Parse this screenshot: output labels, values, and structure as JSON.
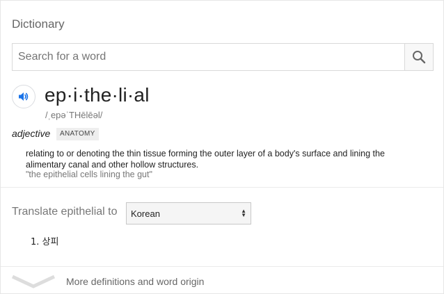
{
  "heading": "Dictionary",
  "search": {
    "placeholder": "Search for a word",
    "value": ""
  },
  "entry": {
    "word": "ep·i·the·li·al",
    "phonetic": "/ˌepəˈTHēlēəl/",
    "part_of_speech": "adjective",
    "label": "ANATOMY",
    "definition": "relating to or denoting the thin tissue forming the outer layer of a body's surface and lining the alimentary canal and other hollow structures.",
    "example": "\"the epithelial cells lining the gut\""
  },
  "translate": {
    "label": "Translate epithelial to",
    "selected_language": "Korean",
    "results": [
      {
        "number": "1.",
        "text": "상피"
      }
    ]
  },
  "footer": {
    "more_label": "More definitions and word origin"
  },
  "colors": {
    "speaker_icon": "#1a73e8",
    "muted_text": "#777777"
  },
  "icons": {
    "search": "search-icon",
    "speaker": "speaker-icon",
    "expand": "chevron-down-icon",
    "select_arrows": "up-down-arrows-icon"
  }
}
